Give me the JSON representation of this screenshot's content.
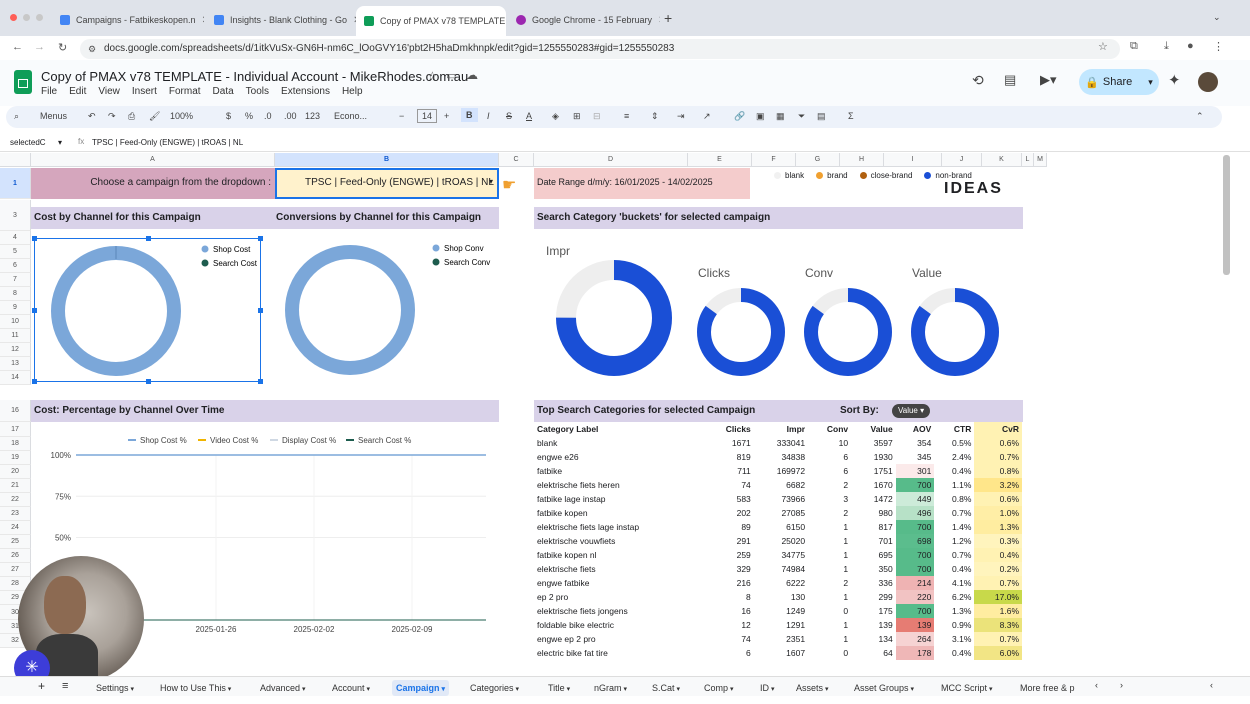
{
  "browser": {
    "tabs": [
      {
        "label": "Campaigns - Fatbikeskopen.n",
        "color": "#4285f4"
      },
      {
        "label": "Insights - Blank Clothing - Go",
        "color": "#4285f4"
      },
      {
        "label": "Copy of PMAX v78 TEMPLATE",
        "color": "#0f9d58"
      },
      {
        "label": "Google Chrome - 15 February",
        "color": "#9c27b0"
      }
    ],
    "url": "docs.google.com/spreadsheets/d/1itkVuSx-GN6H-nm6C_lOoGVY16'pbt2H5haDmkhnpk/edit?gid=1255550283#gid=1255550283"
  },
  "doc": {
    "title": "Copy of PMAX v78 TEMPLATE - Individual Account - MikeRhodes.com.au",
    "menus": [
      "File",
      "Edit",
      "View",
      "Insert",
      "Format",
      "Data",
      "Tools",
      "Extensions",
      "Help"
    ],
    "share_label": "Share"
  },
  "toolbar": {
    "search": "Menus",
    "zoom": "100%",
    "currency": "$",
    "percent": "%",
    "dec_minus": ".0",
    "dec_plus": ".00",
    "num": "123",
    "font": "Econo...",
    "font_size": "14"
  },
  "formula_bar": {
    "name_box": "selectedC",
    "fx": "TPSC | Feed-Only (ENGWE) | tROAS | NL"
  },
  "columns": [
    "A",
    "B",
    "C",
    "D",
    "E",
    "F",
    "G",
    "H",
    "I",
    "J",
    "K",
    "L",
    "M"
  ],
  "rows": [
    "1",
    "3",
    "4",
    "5",
    "6",
    "7",
    "8",
    "9",
    "10",
    "11",
    "12",
    "13",
    "14",
    "16",
    "17",
    "18",
    "19",
    "20",
    "21",
    "22",
    "23",
    "24",
    "25",
    "26",
    "27",
    "28",
    "29",
    "30",
    "31",
    "32"
  ],
  "sheet": {
    "prompt": "Choose a campaign from the dropdown :",
    "campaign": "TPSC | Feed-Only (ENGWE) | tROAS | NL",
    "date_range": "Date Range d/m/y:  16/01/2025 - 14/02/2025",
    "legend": [
      {
        "label": "blank",
        "color": "#f1f1f1"
      },
      {
        "label": "brand",
        "color": "#f0a030"
      },
      {
        "label": "close-brand",
        "color": "#b06010"
      },
      {
        "label": "non-brand",
        "color": "#1a4fd6"
      }
    ],
    "ideas": "IDEAS",
    "cost_title": "Cost by Channel for this Campaign",
    "conv_title": "Conversions by Channel for this Campaign",
    "search_title": "Search Category 'buckets' for selected campaign",
    "cost_legend": [
      "Shop Cost",
      "Search Cost"
    ],
    "conv_legend": [
      "Shop Conv",
      "Search Conv"
    ],
    "donut_labels": [
      "Impr",
      "Clicks",
      "Conv",
      "Value"
    ],
    "pct_title": "Cost: Percentage by Channel Over Time",
    "pct_legend": [
      {
        "label": "Shop Cost %",
        "color": "#7ba7d9"
      },
      {
        "label": "Video Cost %",
        "color": "#f0b400"
      },
      {
        "label": "Display Cost %",
        "color": "#cfd8e3"
      },
      {
        "label": "Search Cost %",
        "color": "#1d5c4e"
      }
    ],
    "top_title": "Top Search Categories for selected Campaign",
    "sort_by": "Sort By:",
    "sort_value": "Value"
  },
  "chart_data": [
    {
      "type": "pie",
      "title": "Cost by Channel for this Campaign",
      "categories": [
        "Shop Cost",
        "Search Cost"
      ],
      "values": [
        100,
        0
      ]
    },
    {
      "type": "pie",
      "title": "Conversions by Channel for this Campaign",
      "categories": [
        "Shop Conv",
        "Search Conv"
      ],
      "values": [
        100,
        0
      ]
    },
    {
      "type": "pie",
      "title": "Impr",
      "categories": [
        "non-brand",
        "blank"
      ],
      "values": [
        75,
        25
      ]
    },
    {
      "type": "pie",
      "title": "Clicks",
      "categories": [
        "non-brand",
        "blank"
      ],
      "values": [
        85,
        15
      ]
    },
    {
      "type": "pie",
      "title": "Conv",
      "categories": [
        "non-brand",
        "blank"
      ],
      "values": [
        85,
        15
      ]
    },
    {
      "type": "pie",
      "title": "Value",
      "categories": [
        "non-brand",
        "blank"
      ],
      "values": [
        85,
        15
      ]
    },
    {
      "type": "line",
      "title": "Cost: Percentage by Channel Over Time",
      "x": [
        "2025-01-26",
        "2025-02-02",
        "2025-02-09"
      ],
      "ytick_labels": [
        "100%",
        "75%",
        "50%"
      ],
      "ylim": [
        0,
        100
      ],
      "series": [
        {
          "name": "Shop Cost %",
          "values": [
            100,
            100,
            100
          ]
        },
        {
          "name": "Video Cost %",
          "values": [
            0,
            0,
            0
          ]
        },
        {
          "name": "Display Cost %",
          "values": [
            0,
            0,
            0
          ]
        },
        {
          "name": "Search Cost %",
          "values": [
            0,
            0,
            0
          ]
        }
      ]
    }
  ],
  "table": {
    "headers": [
      "Category Label",
      "Clicks",
      "Impr",
      "Conv",
      "Value",
      "AOV",
      "CTR",
      "CvR"
    ],
    "rows": [
      [
        "blank",
        "1671",
        "333041",
        "10",
        "3597",
        "354",
        "0.5%",
        "0.6%"
      ],
      [
        "engwe e26",
        "819",
        "34838",
        "6",
        "1930",
        "345",
        "2.4%",
        "0.7%"
      ],
      [
        "fatbike",
        "711",
        "169972",
        "6",
        "1751",
        "301",
        "0.4%",
        "0.8%"
      ],
      [
        "elektrische fiets heren",
        "74",
        "6682",
        "2",
        "1670",
        "700",
        "1.1%",
        "3.2%"
      ],
      [
        "fatbike lage instap",
        "583",
        "73966",
        "3",
        "1472",
        "449",
        "0.8%",
        "0.6%"
      ],
      [
        "fatbike kopen",
        "202",
        "27085",
        "2",
        "980",
        "496",
        "0.7%",
        "1.0%"
      ],
      [
        "elektrische fiets lage instap",
        "89",
        "6150",
        "1",
        "817",
        "700",
        "1.4%",
        "1.3%"
      ],
      [
        "elektrische vouwfiets",
        "291",
        "25020",
        "1",
        "701",
        "698",
        "1.2%",
        "0.3%"
      ],
      [
        "fatbike kopen nl",
        "259",
        "34775",
        "1",
        "695",
        "700",
        "0.7%",
        "0.4%"
      ],
      [
        "elektrische fiets",
        "329",
        "74984",
        "1",
        "350",
        "700",
        "0.4%",
        "0.2%"
      ],
      [
        "engwe fatbike",
        "216",
        "6222",
        "2",
        "336",
        "214",
        "4.1%",
        "0.7%"
      ],
      [
        "ep 2 pro",
        "8",
        "130",
        "1",
        "299",
        "220",
        "6.2%",
        "17.0%"
      ],
      [
        "elektrische fiets jongens",
        "16",
        "1249",
        "0",
        "175",
        "700",
        "1.3%",
        "1.6%"
      ],
      [
        "foldable bike electric",
        "12",
        "1291",
        "1",
        "139",
        "139",
        "0.9%",
        "8.3%"
      ],
      [
        "engwe ep 2 pro",
        "74",
        "2351",
        "1",
        "134",
        "264",
        "3.1%",
        "0.7%"
      ],
      [
        "electric bike fat tire",
        "6",
        "1607",
        "0",
        "64",
        "178",
        "0.4%",
        "6.0%"
      ]
    ],
    "aov_colors": [
      "#fff",
      "#fff",
      "#fbeaea",
      "#57bb8a",
      "#cdebd9",
      "#b7e1c7",
      "#57bb8a",
      "#5bbd8d",
      "#57bb8a",
      "#57bb8a",
      "#efb3b3",
      "#f2c3c3",
      "#57bb8a",
      "#e67c73",
      "#f6d3d3",
      "#efb7b7"
    ],
    "cvr_colors": [
      "#fff2b3",
      "#fff2b3",
      "#fff2b3",
      "#ffe68a",
      "#fff2b3",
      "#ffeea6",
      "#ffeda0",
      "#fff4bd",
      "#fff2b3",
      "#fff4bd",
      "#fff2b3",
      "#c8d94a",
      "#ffeda0",
      "#ebe37a",
      "#fff2b3",
      "#f2e585"
    ]
  },
  "sheet_tabs": [
    "Settings",
    "How to Use This",
    "Advanced",
    "Account",
    "Campaign",
    "Categories",
    "Title",
    "nGram",
    "S.Cat",
    "Comp",
    "ID",
    "Assets",
    "Asset Groups",
    "MCC Script",
    "More free & p"
  ],
  "active_sheet_tab": "Campaign"
}
